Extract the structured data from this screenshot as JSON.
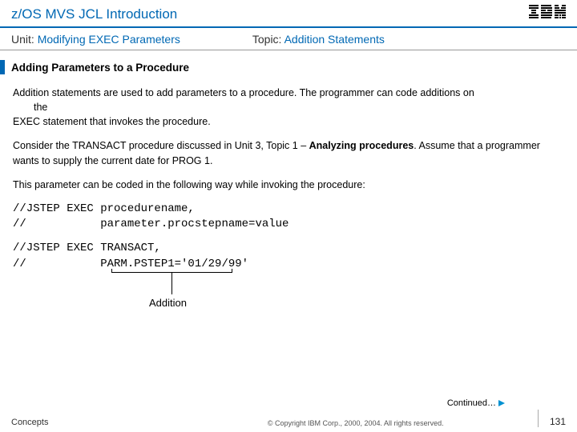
{
  "header": {
    "title": "z/OS MVS JCL Introduction",
    "logo_name": "ibm-logo"
  },
  "subheader": {
    "unit_prefix": "Unit: ",
    "unit_link": "Modifying EXEC Parameters",
    "topic_prefix": "Topic: ",
    "topic_link": "Addition Statements"
  },
  "section_title": "Adding Parameters to a Procedure",
  "body": {
    "para1_a": "Addition statements are used to add parameters to a procedure. The programmer can code additions on",
    "para1_b": "the",
    "para1_c": "EXEC statement that invokes the procedure.",
    "para2_a": "Consider the TRANSACT procedure discussed in Unit 3, Topic 1 – ",
    "para2_bold": "Analyzing procedures",
    "para2_b": ". Assume that a programmer wants to supply the current date for PROG 1.",
    "para3": "This parameter can be coded in the following way while invoking the procedure:"
  },
  "code1": "//JSTEP EXEC procedurename,\n//           parameter.procstepname=value",
  "code2": "//JSTEP EXEC TRANSACT,\n//           PARM.PSTEP1='01/29/99'",
  "annotation": "Addition",
  "continued": "Continued…",
  "footer": {
    "left": "Concepts",
    "center": "© Copyright IBM Corp., 2000, 2004. All rights reserved.",
    "page": "131"
  }
}
